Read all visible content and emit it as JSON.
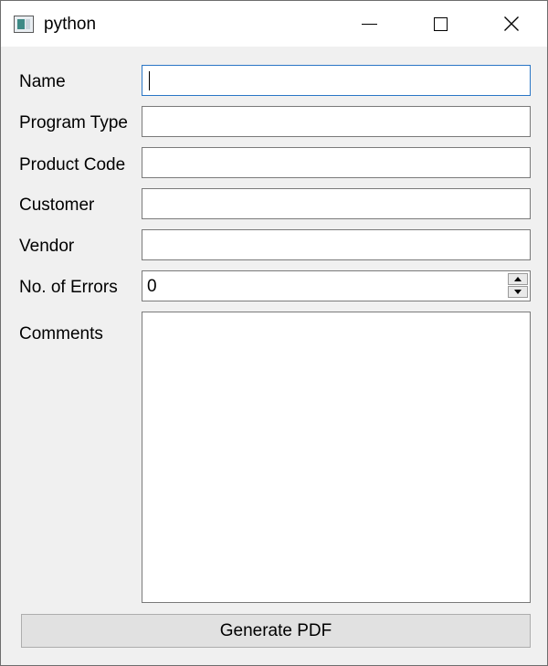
{
  "window": {
    "title": "python",
    "app_icon": "python-app-icon",
    "controls": {
      "minimize_icon": "minimize-icon",
      "maximize_icon": "maximize-icon",
      "close_icon": "close-icon",
      "close_glyph": "✕"
    }
  },
  "form": {
    "fields": [
      {
        "label": "Name",
        "value": "",
        "focused": true
      },
      {
        "label": "Program Type",
        "value": ""
      },
      {
        "label": "Product Code",
        "value": ""
      },
      {
        "label": "Customer",
        "value": ""
      },
      {
        "label": "Vendor",
        "value": ""
      }
    ],
    "errors": {
      "label": "No. of Errors",
      "value": "0"
    },
    "comments": {
      "label": "Comments",
      "value": ""
    },
    "generate_button": "Generate PDF"
  },
  "colors": {
    "window_bg": "#f0f0f0",
    "titlebar_bg": "#ffffff",
    "field_border": "#7a7a7a",
    "focus_border": "#2a76c6",
    "button_bg": "#e1e1e1"
  }
}
